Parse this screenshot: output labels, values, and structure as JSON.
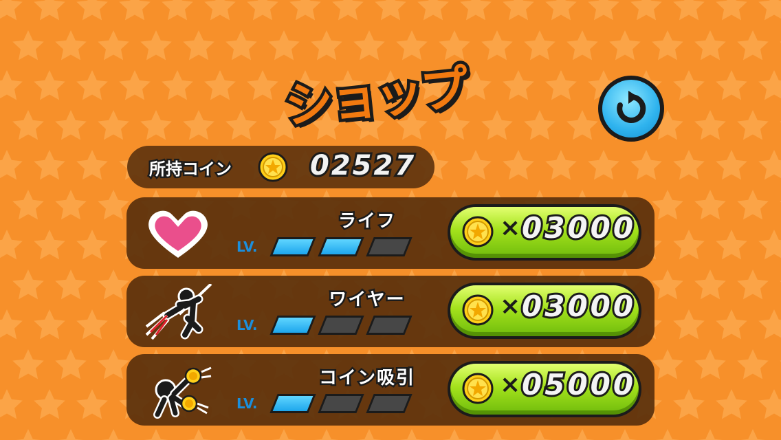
{
  "screen": {
    "title": "ショップ",
    "background_color": "#f7902a"
  },
  "wallet": {
    "label": "所持コイン",
    "coin_icon": "star-coin-icon",
    "count": "02527"
  },
  "back_button": {
    "icon": "rotate-back-icon",
    "color": "#2fb3ee"
  },
  "level_label": "LV.",
  "items": [
    {
      "name": "ライフ",
      "icon": "heart-icon",
      "level": 2,
      "max_level": 3,
      "times": "×",
      "price": "03000"
    },
    {
      "name": "ワイヤー",
      "icon": "wire-stickman-icon",
      "level": 1,
      "max_level": 3,
      "times": "×",
      "price": "03000"
    },
    {
      "name": "コイン吸引",
      "icon": "coin-magnet-stickman-icon",
      "level": 1,
      "max_level": 3,
      "times": "×",
      "price": "05000"
    }
  ],
  "colors": {
    "level_on": "#1ea6ec",
    "level_off": "#474747",
    "buy_button": "#a4e21c",
    "panel": "#5a300c"
  }
}
